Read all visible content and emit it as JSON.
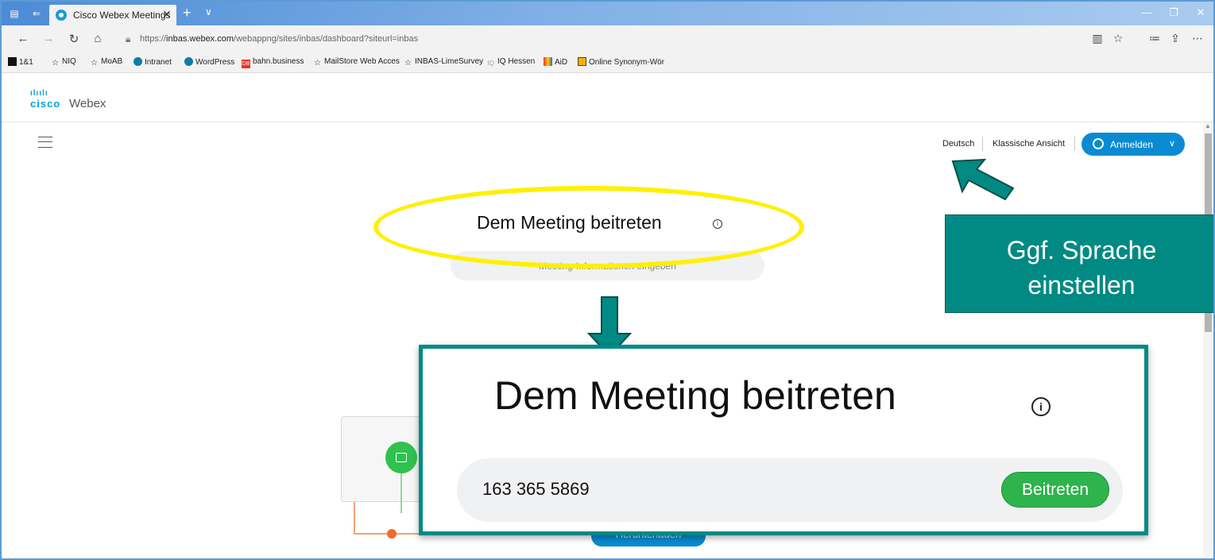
{
  "browser": {
    "tab_title": "Cisco Webex Meetings",
    "tab_close": "✕",
    "new_tab": "+",
    "tab_menu": "∨",
    "url_prefix": "https://",
    "url_host": "inbas.webex.com",
    "url_path": "/webappng/sites/inbas/dashboard?siteurl=inbas",
    "favorites": [
      {
        "label": "1&1",
        "icon": "black-square-icon"
      },
      {
        "label": "NIQ",
        "icon": "star-icon"
      },
      {
        "label": "MoAB",
        "icon": "star-icon"
      },
      {
        "label": "Intranet",
        "icon": "teal-drop-icon"
      },
      {
        "label": "WordPress",
        "icon": "teal-drop-icon"
      },
      {
        "label": "bahn.business",
        "icon": "db-icon"
      },
      {
        "label": "MailStore Web Acces",
        "icon": "star-icon"
      },
      {
        "label": "INBAS-LimeSurvey",
        "icon": "star-icon"
      },
      {
        "label": "IQ Hessen",
        "icon": "iq-icon"
      },
      {
        "label": "AiD",
        "icon": "grid-icon"
      },
      {
        "label": "Online Synonym-Wör",
        "icon": "book-icon"
      }
    ]
  },
  "header": {
    "brand_bars": "ılıılı",
    "brand_cisco": "cisco",
    "brand_webex": "Webex"
  },
  "topnav": {
    "language": "Deutsch",
    "classic_view": "Klassische Ansicht",
    "sign_in": "Anmelden"
  },
  "main": {
    "join_title": "Dem Meeting beitreten",
    "info_symbol": "i",
    "input_placeholder": "Meeting-Informationen eingeben",
    "download_label": "Herunterladen"
  },
  "callout": {
    "line1": "Ggf. Sprache",
    "line2": "einstellen",
    "color": "#008a83"
  },
  "zoom": {
    "title": "Dem Meeting beitreten",
    "info_symbol": "i",
    "meeting_number": "163 365 5869",
    "join_button": "Beitreten"
  },
  "colors": {
    "accent_blue": "#0a8bd1",
    "join_green": "#2eb34d",
    "highlight_yellow": "#fff000",
    "callout_teal": "#008a83"
  }
}
